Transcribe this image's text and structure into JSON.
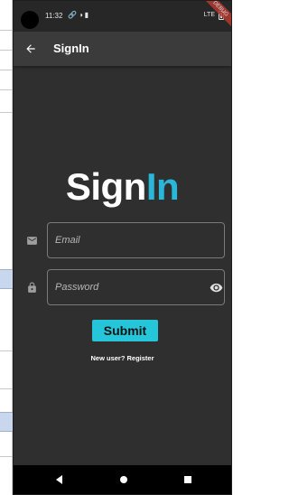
{
  "status_bar": {
    "time": "11:32",
    "network": "LTE",
    "debug_banner": "DEBUG"
  },
  "app_bar": {
    "title": "SignIn"
  },
  "logo": {
    "part1": "Sign",
    "part2": "In",
    "color_primary": "#ffffff",
    "color_accent": "#29b6d8"
  },
  "form": {
    "email": {
      "placeholder": "Email",
      "value": ""
    },
    "password": {
      "placeholder": "Password",
      "value": ""
    },
    "submit_label": "Submit",
    "register_text": "New user? Register"
  },
  "colors": {
    "background": "#2f2f2f",
    "app_bar": "#3b3b3b",
    "submit": "#26c6da"
  },
  "icons": {
    "back": "arrow-left",
    "email": "mail",
    "password": "lock",
    "toggle_visibility": "eye",
    "nav_back": "triangle-left",
    "nav_home": "circle",
    "nav_recents": "square"
  }
}
